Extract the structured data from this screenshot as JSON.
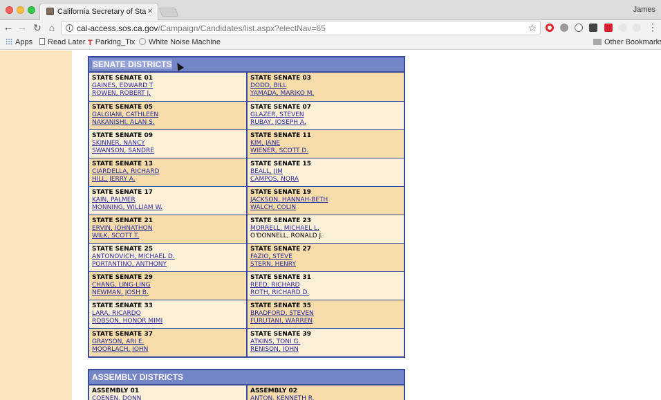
{
  "browser": {
    "tab_title": "California Secretary of State -",
    "tab_close": "×",
    "profile_name": "James",
    "url_host": "cal-access.sos.ca.gov",
    "url_path": "/Campaign/Candidates/list.aspx?electNav=65"
  },
  "bookmarks": {
    "apps": "Apps",
    "read_later": "Read Later",
    "parking": "Parking_Tix",
    "white_noise": "White Noise Machine",
    "other": "Other Bookmarks"
  },
  "senate": {
    "title": "SENATE DISTRICTS",
    "rows": [
      [
        {
          "name": "STATE SENATE 01",
          "cands": [
            "GAINES, EDWARD T",
            "ROWEN, ROBERT J."
          ]
        },
        {
          "name": "STATE SENATE 03",
          "cands": [
            "DODD, BILL",
            "YAMADA, MARIKO M."
          ]
        }
      ],
      [
        {
          "name": "STATE SENATE 05",
          "cands": [
            "GALGIANI, CATHLEEN",
            "NAKANISHI, ALAN S."
          ]
        },
        {
          "name": "STATE SENATE 07",
          "cands": [
            "GLAZER, STEVEN",
            "RUBAY, JOSEPH A."
          ]
        }
      ],
      [
        {
          "name": "STATE SENATE 09",
          "cands": [
            "SKINNER, NANCY",
            "SWANSON, SANDRE"
          ]
        },
        {
          "name": "STATE SENATE 11",
          "cands": [
            "KIM, JANE",
            "WIENER, SCOTT D."
          ]
        }
      ],
      [
        {
          "name": "STATE SENATE 13",
          "cands": [
            "CIARDELLA, RICHARD",
            "HILL, JERRY A."
          ]
        },
        {
          "name": "STATE SENATE 15",
          "cands": [
            "BEALL, JIM",
            "CAMPOS, NORA"
          ]
        }
      ],
      [
        {
          "name": "STATE SENATE 17",
          "cands": [
            "KAIN, PALMER",
            "MONNING, WILLIAM W."
          ]
        },
        {
          "name": "STATE SENATE 19",
          "cands": [
            "JACKSON, HANNAH-BETH",
            "WALCH, COLIN"
          ]
        }
      ],
      [
        {
          "name": "STATE SENATE 21",
          "cands": [
            "ERVIN, JOHNATHON",
            "WILK, SCOTT T."
          ]
        },
        {
          "name": "STATE SENATE 23",
          "cands": [
            "MORRELL, MICHAEL L.",
            "O'DONNELL, RONALD J."
          ]
        }
      ],
      [
        {
          "name": "STATE SENATE 25",
          "cands": [
            "ANTONOVICH, MICHAEL D.",
            "PORTANTINO, ANTHONY"
          ]
        },
        {
          "name": "STATE SENATE 27",
          "cands": [
            "FAZIO, STEVE",
            "STERN, HENRY"
          ]
        }
      ],
      [
        {
          "name": "STATE SENATE 29",
          "cands": [
            "CHANG, LING-LING",
            "NEWMAN, JOSH B."
          ]
        },
        {
          "name": "STATE SENATE 31",
          "cands": [
            "REED, RICHARD",
            "ROTH, RICHARD D."
          ]
        }
      ],
      [
        {
          "name": "STATE SENATE 33",
          "cands": [
            "LARA, RICARDO",
            "ROBSON, HONOR MIMI"
          ]
        },
        {
          "name": "STATE SENATE 35",
          "cands": [
            "BRADFORD, STEVEN",
            "FURUTANI, WARREN"
          ]
        }
      ],
      [
        {
          "name": "STATE SENATE 37",
          "cands": [
            "GRAYSON, ARI E.",
            "MOORLACH, JOHN"
          ]
        },
        {
          "name": "STATE SENATE 39",
          "cands": [
            "ATKINS, TONI G.",
            "RENISON, JOHN"
          ]
        }
      ]
    ]
  },
  "assembly": {
    "title": "ASSEMBLY DISTRICTS",
    "rows": [
      [
        {
          "name": "ASSEMBLY 01",
          "cands": [
            "COENEN, DONN"
          ]
        },
        {
          "name": "ASSEMBLY 02",
          "cands": [
            "ANTON, KENNETH R."
          ]
        }
      ]
    ]
  }
}
